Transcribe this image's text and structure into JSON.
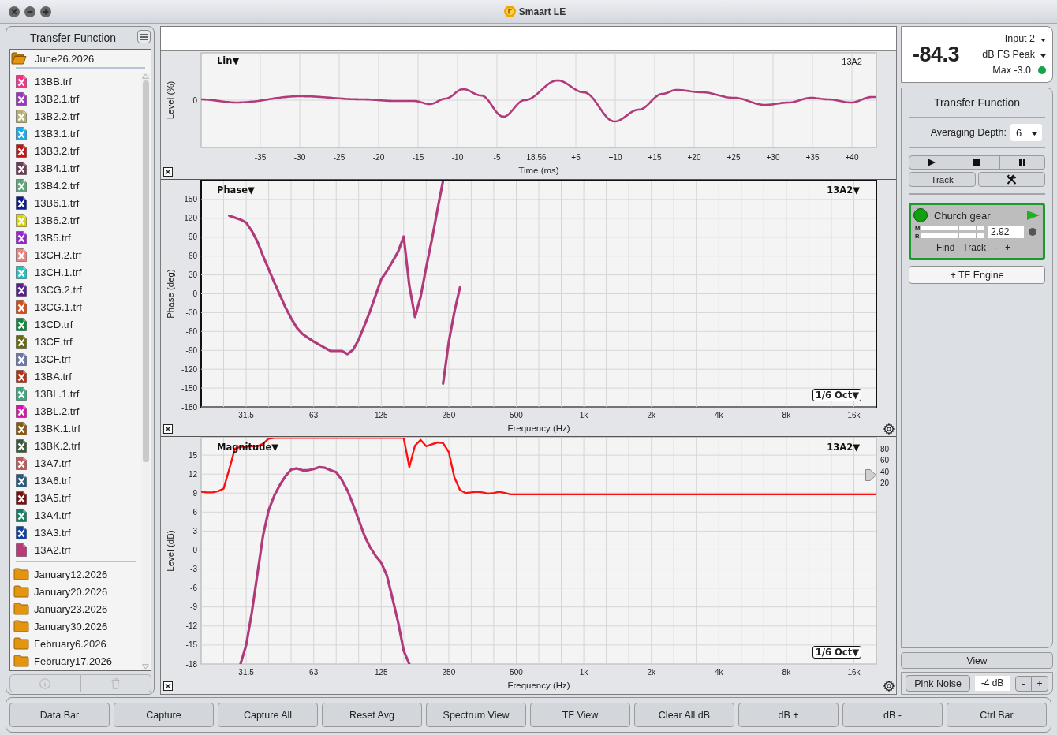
{
  "window": {
    "title": "Smaart LE"
  },
  "sidebar": {
    "title": "Transfer Function",
    "tree": [
      {
        "label": "June26.2026",
        "expanded": true,
        "children": [
          {
            "label": "13BB.trf",
            "color": "#ff2d8a",
            "hidden": true
          },
          {
            "label": "13B2.1.trf",
            "color": "#a030c8",
            "hidden": true
          },
          {
            "label": "13B2.2.trf",
            "color": "#b8b070",
            "hidden": true
          },
          {
            "label": "13B3.1.trf",
            "color": "#12b0f0",
            "hidden": true
          },
          {
            "label": "13B3.2.trf",
            "color": "#cc1010",
            "hidden": true
          },
          {
            "label": "13B4.1.trf",
            "color": "#6e3a56",
            "hidden": true
          },
          {
            "label": "13B4.2.trf",
            "color": "#5aa878",
            "hidden": true
          },
          {
            "label": "13B6.1.trf",
            "color": "#0a1a90",
            "hidden": true
          },
          {
            "label": "13B6.2.trf",
            "color": "#d8d800",
            "hidden": true
          },
          {
            "label": "13B5.trf",
            "color": "#9a22d8",
            "hidden": true
          },
          {
            "label": "13CH.2.trf",
            "color": "#f48080",
            "hidden": true
          },
          {
            "label": "13CH.1.trf",
            "color": "#14c8c8",
            "hidden": true
          },
          {
            "label": "13CG.2.trf",
            "color": "#5a2090",
            "hidden": true
          },
          {
            "label": "13CG.1.trf",
            "color": "#e04a10",
            "hidden": true
          },
          {
            "label": "13CD.trf",
            "color": "#0a8a3a",
            "hidden": true
          },
          {
            "label": "13CE.trf",
            "color": "#6a6a10",
            "hidden": true
          },
          {
            "label": "13CF.trf",
            "color": "#6878b0",
            "hidden": true
          },
          {
            "label": "13BA.trf",
            "color": "#b83010",
            "hidden": true
          },
          {
            "label": "13BL.1.trf",
            "color": "#3aaa80",
            "hidden": true
          },
          {
            "label": "13BL.2.trf",
            "color": "#e010b0",
            "hidden": true
          },
          {
            "label": "13BK.1.trf",
            "color": "#8a5a10",
            "hidden": true
          },
          {
            "label": "13BK.2.trf",
            "color": "#3a5a3a",
            "hidden": true
          },
          {
            "label": "13A7.trf",
            "color": "#c05a5a",
            "hidden": true
          },
          {
            "label": "13A6.trf",
            "color": "#2a5a80",
            "hidden": true
          },
          {
            "label": "13A5.trf",
            "color": "#7a1010",
            "hidden": true
          },
          {
            "label": "13A4.trf",
            "color": "#108060",
            "hidden": true
          },
          {
            "label": "13A3.trf",
            "color": "#1040a0",
            "hidden": true
          },
          {
            "label": "13A2.trf",
            "color": "#b83a7a",
            "hidden": false
          }
        ]
      },
      {
        "label": "January12.2026",
        "expanded": false
      },
      {
        "label": "January20.2026",
        "expanded": false
      },
      {
        "label": "January23.2026",
        "expanded": false
      },
      {
        "label": "January30.2026",
        "expanded": false
      },
      {
        "label": "February6.2026",
        "expanded": false
      },
      {
        "label": "February17.2026",
        "expanded": false
      }
    ],
    "footer_buttons": [
      {
        "kind": "info",
        "disabled": true
      },
      {
        "kind": "delete",
        "disabled": true
      }
    ]
  },
  "time_plot": {
    "mode": "Lin▼",
    "trace": "13A2",
    "ylabel": "Level (%)",
    "yticks": [
      "0"
    ],
    "xlabel": "Time (ms)",
    "xticks": [
      "-35",
      "-30",
      "-25",
      "-20",
      "-15",
      "-10",
      "-5",
      "18.56",
      "+5",
      "+10",
      "+15",
      "+20",
      "+25",
      "+30",
      "+35",
      "+40"
    ]
  },
  "phase_plot": {
    "mode": "Phase▼",
    "trace": "13A2▼",
    "smoothing": "1/6 Oct▼",
    "active": true,
    "chart_data": {
      "type": "line",
      "xlabel": "Frequency (Hz)",
      "ylabel": "Phase (deg)",
      "grid": true,
      "ylim": [
        -180,
        180
      ],
      "yticks": [
        150,
        120,
        90,
        60,
        30,
        0,
        -30,
        -60,
        -90,
        -120,
        -150,
        -180
      ],
      "categories": [
        null,
        null,
        null,
        null,
        null,
        null,
        null,
        null,
        "31.5",
        null,
        null,
        null,
        null,
        null,
        null,
        null,
        null,
        null,
        null,
        null,
        "63",
        null,
        null,
        null,
        null,
        null,
        null,
        null,
        null,
        null,
        null,
        null,
        "125",
        null,
        null,
        null,
        null,
        null,
        null,
        null,
        null,
        null,
        null,
        null,
        "250",
        null,
        null,
        null,
        null,
        null,
        null,
        null,
        null,
        null,
        null,
        null,
        "500",
        null,
        null,
        null,
        null,
        null,
        null,
        null,
        null,
        null,
        null,
        null,
        "1k",
        null,
        null,
        null,
        null,
        null,
        null,
        null,
        null,
        null,
        null,
        null,
        "2k",
        null,
        null,
        null,
        null,
        null,
        null,
        null,
        null,
        null,
        null,
        null,
        "4k",
        null,
        null,
        null,
        null,
        null,
        null,
        null,
        null,
        null,
        null,
        null,
        "8k",
        null,
        null,
        null,
        null,
        null,
        null,
        null,
        null,
        null,
        null,
        null,
        "16k",
        null,
        null,
        null,
        null
      ],
      "series": [
        {
          "color": "#b03a7a",
          "values": [
            null,
            null,
            null,
            null,
            null,
            124,
            121,
            118,
            113,
            100,
            83,
            60,
            39,
            18,
            -2,
            -22,
            -39,
            -54,
            -64,
            -70,
            -76,
            -81,
            -86,
            -91,
            -91,
            -91,
            -96,
            -89,
            -73,
            -51,
            -28,
            -3,
            23,
            36,
            51,
            67,
            91,
            13,
            -37,
            -5,
            42,
            86,
            134,
            180,
            null,
            null,
            null,
            null,
            null,
            null,
            null,
            null,
            null,
            null,
            null,
            null,
            null,
            null,
            null,
            null,
            null,
            null,
            null,
            null,
            null,
            null,
            null,
            null,
            null,
            null,
            null,
            null,
            null,
            null,
            null,
            null,
            null,
            null,
            null,
            null,
            null,
            null,
            null,
            null,
            null,
            null,
            null,
            null,
            null,
            null,
            null,
            null,
            null,
            null,
            null,
            null,
            null,
            null,
            null,
            null,
            null,
            null,
            null,
            null,
            null,
            null,
            null,
            null,
            null,
            null,
            null,
            null,
            null,
            null,
            null,
            null,
            null,
            null,
            null,
            null,
            null
          ]
        },
        {
          "color": "#b03a7a",
          "values": [
            null,
            null,
            null,
            null,
            null,
            null,
            null,
            null,
            null,
            null,
            null,
            null,
            null,
            null,
            null,
            null,
            null,
            null,
            null,
            null,
            null,
            null,
            null,
            null,
            null,
            null,
            null,
            null,
            null,
            null,
            null,
            null,
            null,
            null,
            null,
            null,
            null,
            null,
            null,
            null,
            null,
            null,
            null,
            -143,
            -77,
            -29,
            10,
            null,
            null,
            null,
            null,
            null,
            null,
            null,
            null,
            null,
            null,
            null,
            null,
            null,
            null,
            null,
            null,
            null,
            null,
            null,
            null,
            null,
            null,
            null,
            null,
            null,
            null,
            null,
            null,
            null,
            null,
            null,
            null,
            null,
            null,
            null,
            null,
            null,
            null,
            null,
            null,
            null,
            null,
            null,
            null,
            null,
            null,
            null,
            null,
            null,
            null,
            null,
            null,
            null,
            null,
            null,
            null,
            null,
            null,
            null,
            null,
            null,
            null,
            null,
            null,
            null,
            null,
            null,
            null,
            null,
            null,
            null,
            null,
            null,
            null
          ]
        }
      ]
    }
  },
  "magnitude_plot": {
    "mode": "Magnitude▼",
    "trace": "13A2▼",
    "smoothing": "1/6 Oct▼",
    "active": false,
    "right_axis_ticks": [
      "80",
      "60",
      "40",
      "20"
    ],
    "chart_data": {
      "type": "line",
      "xlabel": "Frequency (Hz)",
      "ylabel": "Level (dB)",
      "grid": true,
      "ylim": [
        -18,
        17.75
      ],
      "yticks": [
        15,
        12,
        9,
        6,
        3,
        0,
        -3,
        -6,
        -9,
        -12,
        -15,
        -18
      ],
      "ref_lines": [
        {
          "axis": "y",
          "value": 0
        }
      ],
      "categories": [
        null,
        null,
        null,
        null,
        null,
        null,
        null,
        null,
        "31.5",
        null,
        null,
        null,
        null,
        null,
        null,
        null,
        null,
        null,
        null,
        null,
        "63",
        null,
        null,
        null,
        null,
        null,
        null,
        null,
        null,
        null,
        null,
        null,
        "125",
        null,
        null,
        null,
        null,
        null,
        null,
        null,
        null,
        null,
        null,
        null,
        "250",
        null,
        null,
        null,
        null,
        null,
        null,
        null,
        null,
        null,
        null,
        null,
        "500",
        null,
        null,
        null,
        null,
        null,
        null,
        null,
        null,
        null,
        null,
        null,
        "1k",
        null,
        null,
        null,
        null,
        null,
        null,
        null,
        null,
        null,
        null,
        null,
        "2k",
        null,
        null,
        null,
        null,
        null,
        null,
        null,
        null,
        null,
        null,
        null,
        "4k",
        null,
        null,
        null,
        null,
        null,
        null,
        null,
        null,
        null,
        null,
        null,
        "8k",
        null,
        null,
        null,
        null,
        null,
        null,
        null,
        null,
        null,
        null,
        null,
        "16k",
        null,
        null,
        null,
        null
      ],
      "series": [
        {
          "color": "#b03a7a",
          "values": [
            null,
            null,
            null,
            null,
            null,
            null,
            null,
            -18,
            -15,
            -9.9,
            -3.8,
            2.3,
            6.3,
            8.6,
            10.3,
            11.7,
            12.7,
            12.9,
            12.6,
            12.6,
            12.8,
            13.1,
            13.0,
            12.6,
            12.3,
            11.1,
            9.4,
            7.2,
            4.8,
            2.3,
            0.5,
            -0.9,
            -2.0,
            -4.0,
            -7.6,
            -11.4,
            -15.9,
            -18,
            null,
            null,
            null,
            null,
            null,
            null,
            null,
            null,
            null,
            null,
            null,
            null,
            null,
            null,
            null,
            null,
            null,
            null,
            null,
            null,
            null,
            null,
            null,
            null,
            null,
            null,
            null,
            null,
            null,
            null,
            null,
            null,
            null,
            null,
            null,
            null,
            null,
            null,
            null,
            null,
            null,
            null,
            null,
            null,
            null,
            null,
            null,
            null,
            null,
            null,
            null,
            null,
            null,
            null,
            null,
            null,
            null,
            null,
            null,
            null,
            null,
            null,
            null,
            null,
            null,
            null,
            null,
            null,
            null,
            null,
            null,
            null,
            null,
            null,
            null,
            null,
            null,
            null,
            null,
            null,
            null,
            null,
            null
          ]
        },
        {
          "color": "#ff1010",
          "values": [
            9.2,
            9.1,
            9.1,
            9.3,
            9.7,
            12.8,
            16.0,
            16.3,
            16.3,
            16.4,
            16.4,
            16.8,
            17.6,
            17.7,
            17.7,
            17.7,
            17.7,
            17.7,
            17.7,
            17.7,
            17.7,
            17.7,
            17.7,
            17.7,
            17.7,
            17.7,
            17.7,
            17.7,
            17.7,
            17.7,
            17.7,
            17.7,
            17.7,
            17.7,
            17.7,
            17.7,
            17.7,
            13.1,
            16.5,
            17.4,
            16.4,
            16.7,
            17.0,
            16.9,
            15.5,
            11.5,
            9.5,
            9.0,
            9.1,
            9.2,
            9.1,
            8.9,
            9.0,
            9.2,
            9.0,
            8.8,
            8.8,
            8.8,
            8.8,
            8.8,
            8.8,
            8.8,
            8.8,
            8.8,
            8.8,
            8.8,
            8.8,
            8.8,
            8.8,
            8.8,
            8.8,
            8.8,
            8.8,
            8.8,
            8.8,
            8.8,
            8.8,
            8.8,
            8.8,
            8.8,
            8.8,
            8.8,
            8.8,
            8.8,
            8.8,
            8.8,
            8.8,
            8.8,
            8.8,
            8.8,
            8.8,
            8.8,
            8.8,
            8.8,
            8.8,
            8.8,
            8.8,
            8.8,
            8.8,
            8.8,
            8.8,
            8.8,
            8.8,
            8.8,
            8.8,
            8.8,
            8.8,
            8.8,
            8.8,
            8.8,
            8.8,
            8.8,
            8.8,
            8.8,
            8.8,
            8.8,
            8.8,
            8.8,
            8.8,
            8.8,
            8.8
          ]
        }
      ]
    }
  },
  "meter": {
    "value": "-84.3",
    "input": "Input 2",
    "unit": "dB FS Peak",
    "max": "Max -3.0",
    "max_ok": true
  },
  "tf_panel": {
    "title": "Transfer Function",
    "averaging_label": "Averaging Depth:",
    "averaging_value": "6",
    "track_button": "Track",
    "engine": {
      "name": "Church gear",
      "on": true,
      "meters": [
        {
          "label": "M"
        },
        {
          "label": "R"
        }
      ],
      "value": "2.92",
      "tracking": false,
      "buttons": [
        "Find",
        "Track",
        "-",
        "+"
      ]
    },
    "add_engine": "+ TF Engine"
  },
  "view_button": "View",
  "generator": {
    "button": "Pink Noise",
    "gain": "-4 dB",
    "steps": [
      "-",
      "+"
    ]
  },
  "bottom_bar": [
    "Data Bar",
    "Capture",
    "Capture All",
    "Reset Avg",
    "Spectrum View",
    "TF View",
    "Clear All dB",
    "dB +",
    "dB -",
    "Ctrl Bar"
  ]
}
